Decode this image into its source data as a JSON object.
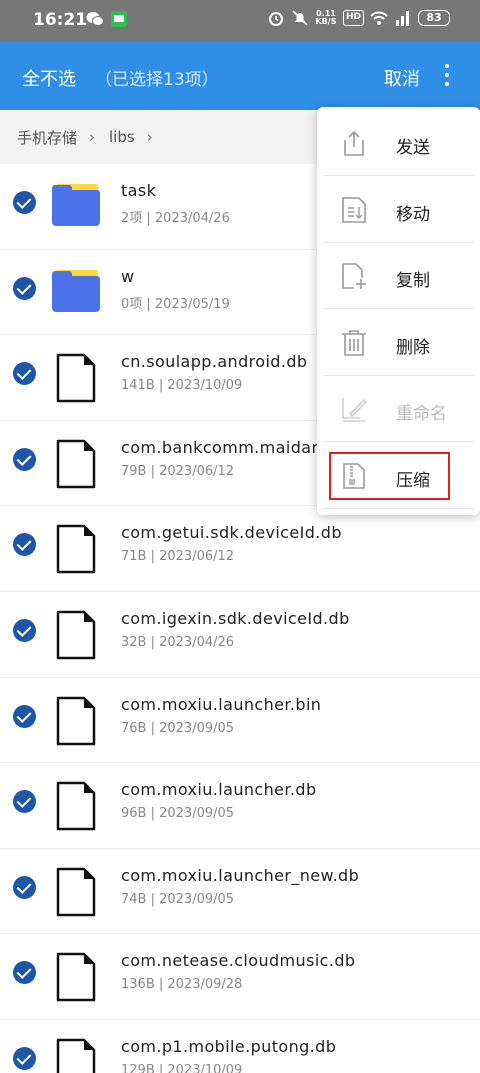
{
  "status_bar": {
    "time": "16:21",
    "net_speed_value": "0.11",
    "net_speed_unit": "KB/S",
    "hd_label": "HD",
    "battery": "83"
  },
  "header": {
    "deselect_all": "全不选",
    "selected_count": "（已选择13项）",
    "cancel": "取消"
  },
  "breadcrumb": {
    "items": [
      "手机存储",
      "libs"
    ]
  },
  "files": [
    {
      "type": "folder",
      "name": "task",
      "meta": "2项 | 2023/04/26"
    },
    {
      "type": "folder",
      "name": "w",
      "meta": "0项 | 2023/05/19"
    },
    {
      "type": "file",
      "name": "cn.soulapp.android.db",
      "meta": "141B | 2023/10/09"
    },
    {
      "type": "file",
      "name": "com.bankcomm.maidan",
      "meta": "79B | 2023/06/12"
    },
    {
      "type": "file",
      "name": "com.getui.sdk.deviceId.db",
      "meta": "71B | 2023/06/12"
    },
    {
      "type": "file",
      "name": "com.igexin.sdk.deviceId.db",
      "meta": "32B | 2023/04/26"
    },
    {
      "type": "file",
      "name": "com.moxiu.launcher.bin",
      "meta": "76B | 2023/09/05"
    },
    {
      "type": "file",
      "name": "com.moxiu.launcher.db",
      "meta": "96B | 2023/09/05"
    },
    {
      "type": "file",
      "name": "com.moxiu.launcher_new.db",
      "meta": "74B | 2023/09/05"
    },
    {
      "type": "file",
      "name": "com.netease.cloudmusic.db",
      "meta": "136B | 2023/09/28"
    },
    {
      "type": "file",
      "name": "com.p1.mobile.putong.db",
      "meta": "129B | 2023/10/09"
    }
  ],
  "menu": {
    "items": [
      {
        "label": "发送",
        "icon": "share-icon",
        "enabled": true
      },
      {
        "label": "移动",
        "icon": "move-icon",
        "enabled": true
      },
      {
        "label": "复制",
        "icon": "copy-icon",
        "enabled": true
      },
      {
        "label": "删除",
        "icon": "trash-icon",
        "enabled": true
      },
      {
        "label": "重命名",
        "icon": "rename-icon",
        "enabled": false
      },
      {
        "label": "压缩",
        "icon": "zip-icon",
        "enabled": true
      }
    ],
    "highlighted_item": "压缩"
  },
  "colors": {
    "accent": "#2f8ee6",
    "check": "#1f57a8",
    "folder_blue": "#4b72e8",
    "folder_yellow": "#ffd93b",
    "highlight_red": "#e0201c"
  }
}
